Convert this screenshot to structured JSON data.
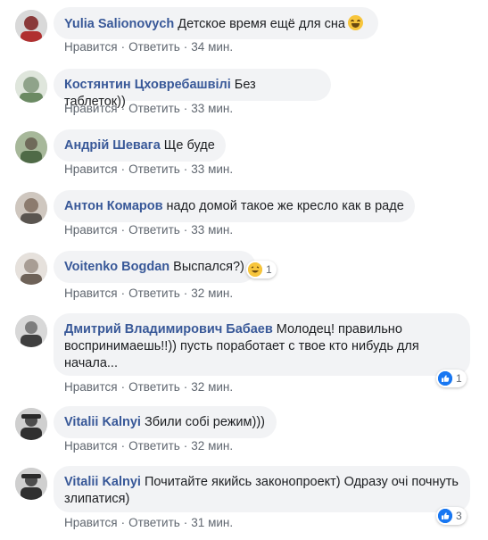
{
  "actions": {
    "like": "Нравится",
    "reply": "Ответить",
    "sep": "·"
  },
  "comments": [
    {
      "author": "Yulia Salionovych",
      "text": "Детское время ещё для сна",
      "time": "34 мин.",
      "emoji": "laughing-emoji",
      "avatar_color": "#8a3a3a"
    },
    {
      "author": "Костянтин Цховребашвілі",
      "text": "Без таблеток))",
      "time": "33 мин.",
      "avatar_color": "#8fa38a"
    },
    {
      "author": "Андрій Шевага",
      "text": "Ще буде",
      "time": "33 мин.",
      "avatar_color": "#6f8a6a"
    },
    {
      "author": "Антон Комаров",
      "text": "надо домой такое же кресло как в раде",
      "time": "33 мин.",
      "avatar_color": "#8c7b6e"
    },
    {
      "author": "Voitenko Bogdan",
      "text": "Выспался?)",
      "time": "32 мин.",
      "reaction": {
        "icon": "haha-icon",
        "count": "1"
      },
      "avatar_color": "#a89d94"
    },
    {
      "author": "Дмитрий Владимирович Бабаев",
      "text": "Молодец! правильно воспринимаешь!!)) пусть поработает с твое кто нибудь для начала...",
      "time": "32 мин.",
      "reaction": {
        "icon": "like-icon",
        "count": "1"
      },
      "avatar_color": "#7d7d7d"
    },
    {
      "author": "Vitalii Kalnyi",
      "text": "Збили собі режим)))",
      "time": "32 мин.",
      "avatar_color": "#4d4d4d"
    },
    {
      "author": "Vitalii Kalnyi",
      "text": "Почитайте якийсь законопроект) Одразу очі почнуть злипатися)",
      "time": "31 мин.",
      "reaction": {
        "icon": "like-icon",
        "count": "3"
      },
      "avatar_color": "#4d4d4d"
    }
  ]
}
